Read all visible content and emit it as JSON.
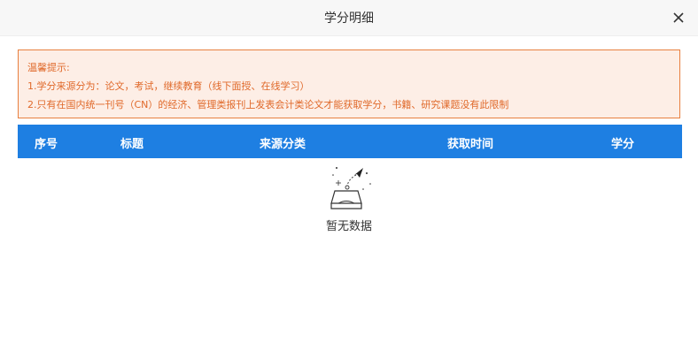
{
  "dialog": {
    "title": "学分明细",
    "close_icon": "close-icon"
  },
  "notice": {
    "heading": "温馨提示:",
    "lines": [
      "1.学分来源分为：论文，考试，继续教育（线下面授、在线学习）",
      "2.只有在国内统一刊号（CN）的经济、管理类报刊上发表会计类论文才能获取学分，书籍、研究课题没有此限制"
    ]
  },
  "table": {
    "columns": [
      "序号",
      "标题",
      "来源分类",
      "获取时间",
      "学分"
    ]
  },
  "empty": {
    "icon": "empty-inbox-icon",
    "text": "暂无数据"
  },
  "colors": {
    "header_bg": "#1e7fe2",
    "notice_bg": "#fdeee6",
    "notice_border": "#e8803f",
    "notice_text": "#e0692a"
  }
}
